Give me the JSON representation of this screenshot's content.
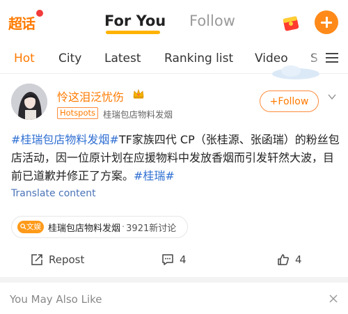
{
  "header": {
    "logo_text": "超话",
    "tabs": [
      {
        "label": "For You",
        "active": true
      },
      {
        "label": "Follow",
        "active": false
      }
    ],
    "accent_color": "#ff7a00",
    "icons": [
      "red-packet-icon",
      "add-icon"
    ]
  },
  "subtabs": {
    "items": [
      {
        "label": "Hot",
        "active": true
      },
      {
        "label": "City",
        "active": false
      },
      {
        "label": "Latest",
        "active": false
      },
      {
        "label": "Ranking list",
        "active": false
      },
      {
        "label": "Video",
        "active": false
      },
      {
        "label": "S",
        "active": false
      }
    ],
    "menu_icon": "menu-icon"
  },
  "post": {
    "username": "怜这泪泛忧伤",
    "badge": "Hotspots",
    "source": "桂瑞包店物料发烟",
    "follow_label": "+Follow",
    "text": {
      "tag1": "#桂瑞包店物料发烟#",
      "body": "TF家族四代 CP（张桂源、张函瑞）的粉丝包店活动，因一位原计划在应援物料中发放香烟而引发轩然大波，目前已道歉并修正了方案。",
      "tag2": "#桂瑞#"
    },
    "translate": "Translate content",
    "topic": {
      "badge": "文娱",
      "title": "桂瑞包店物料发烟",
      "separator": "·",
      "count": "3921新讨论"
    },
    "actions": {
      "repost": "Repost",
      "comments": "4",
      "likes": "4"
    }
  },
  "footer": {
    "also_like": "You May Also Like"
  }
}
